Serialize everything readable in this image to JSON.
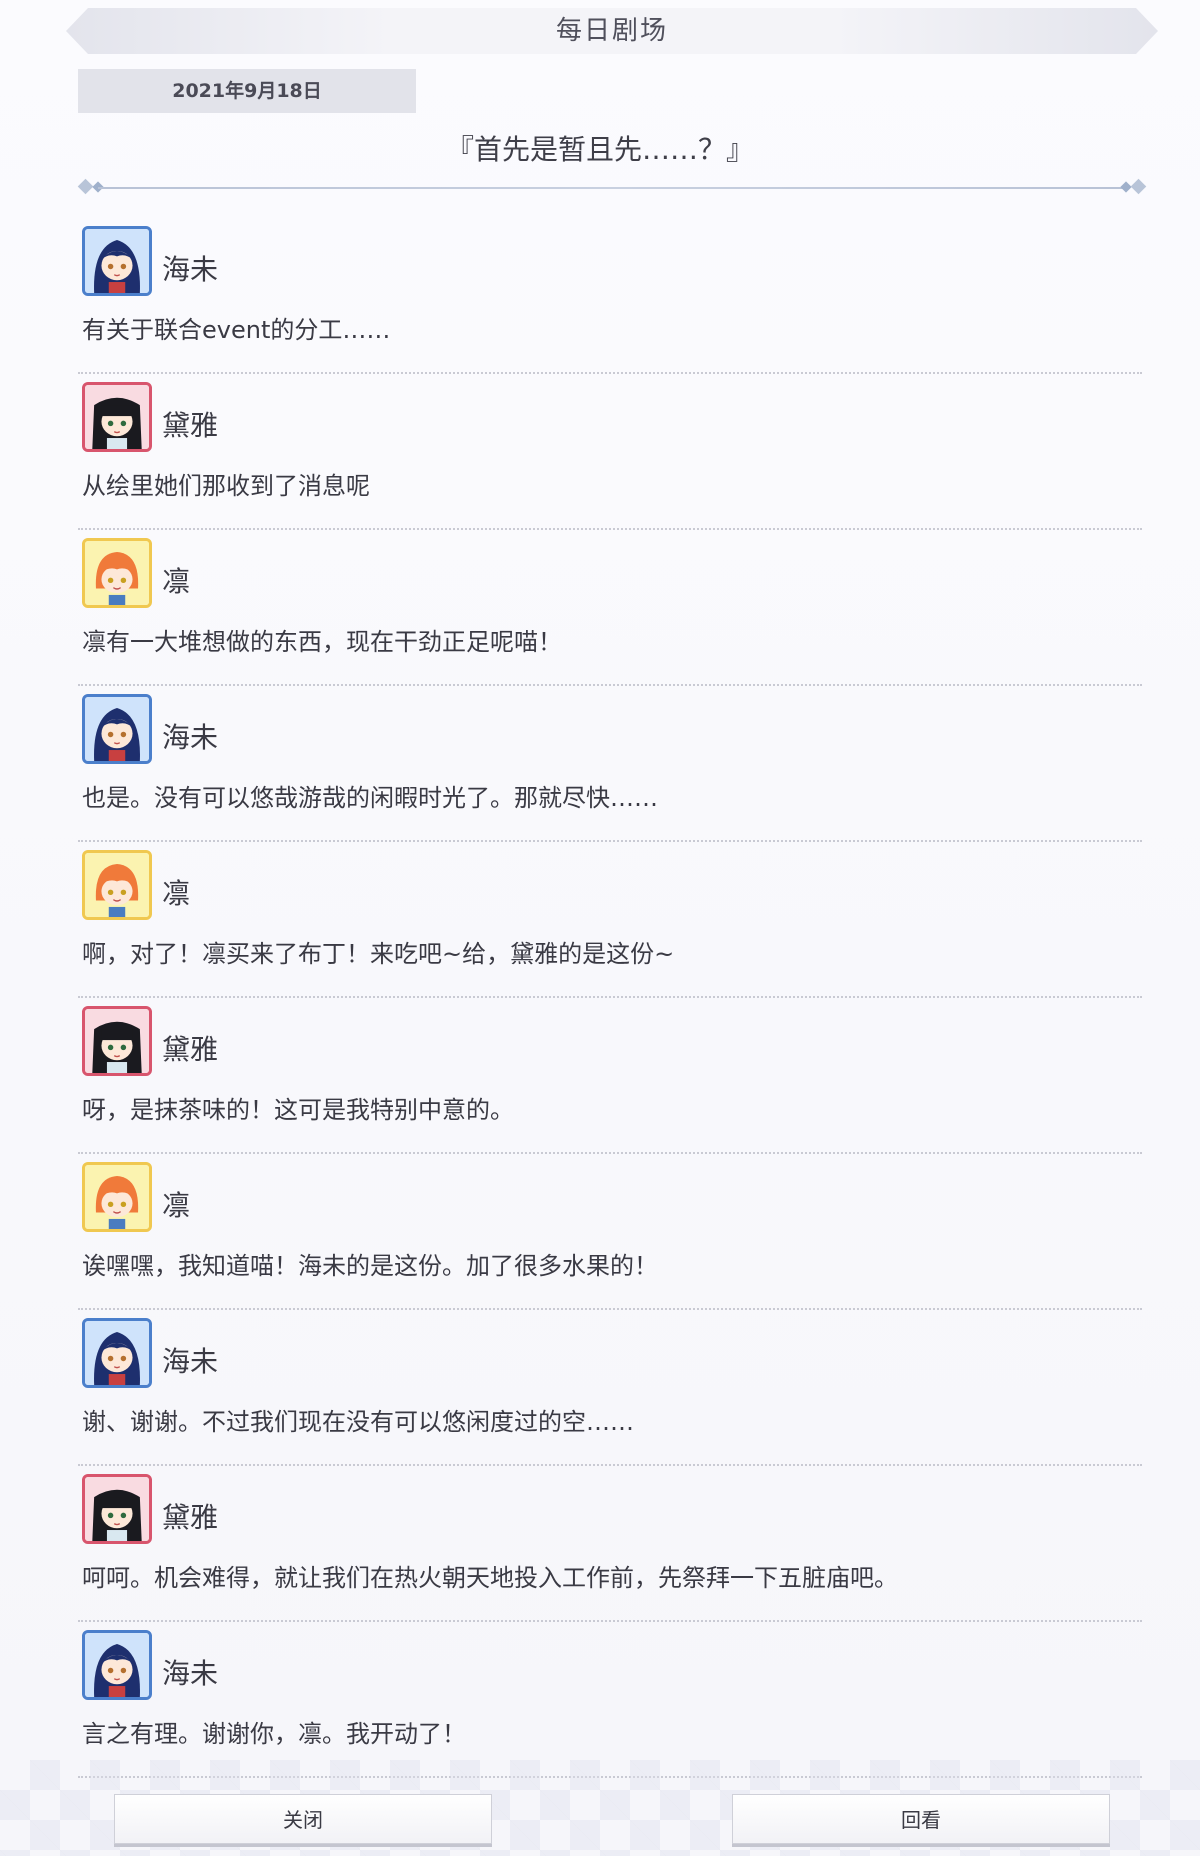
{
  "header": {
    "title": "每日剧场"
  },
  "date": "2021年9月18日",
  "episode_title": "『首先是暂且先……？』",
  "messages": [
    {
      "speaker": "海未",
      "avatar": "umi-avatar",
      "text": "有关于联合event的分工……"
    },
    {
      "speaker": "黛雅",
      "avatar": "dia-avatar",
      "text": "从绘里她们那收到了消息呢"
    },
    {
      "speaker": "凛",
      "avatar": "rin-avatar",
      "text": "凛有一大堆想做的东西，现在干劲正足呢喵！"
    },
    {
      "speaker": "海未",
      "avatar": "umi-avatar",
      "text": "也是。没有可以悠哉游哉的闲暇时光了。那就尽快……"
    },
    {
      "speaker": "凛",
      "avatar": "rin-avatar",
      "text": "啊，对了！凛买来了布丁！来吃吧~给，黛雅的是这份~"
    },
    {
      "speaker": "黛雅",
      "avatar": "dia-avatar",
      "text": "呀，是抹茶味的！这可是我特别中意的。"
    },
    {
      "speaker": "凛",
      "avatar": "rin-avatar",
      "text": "诶嘿嘿，我知道喵！海未的是这份。加了很多水果的！"
    },
    {
      "speaker": "海未",
      "avatar": "umi-avatar",
      "text": "谢、谢谢。不过我们现在没有可以悠闲度过的空……"
    },
    {
      "speaker": "黛雅",
      "avatar": "dia-avatar",
      "text": "呵呵。机会难得，就让我们在热火朝天地投入工作前，先祭拜一下五脏庙吧。"
    },
    {
      "speaker": "海未",
      "avatar": "umi-avatar",
      "text": "言之有理。谢谢你，凛。我开动了！"
    }
  ],
  "buttons": {
    "close": "关闭",
    "replay": "回看"
  },
  "colors": {
    "umi": "#4b7fcb",
    "dia": "#d8556d",
    "rin": "#f0c850"
  }
}
